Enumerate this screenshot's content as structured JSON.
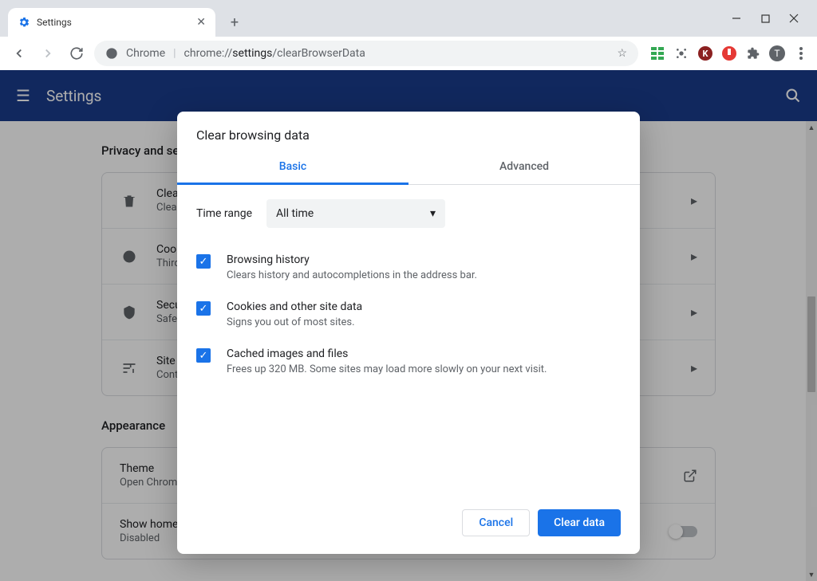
{
  "window": {
    "tab_title": "Settings"
  },
  "omnibox": {
    "prefix": "Chrome",
    "url_bold": "settings",
    "url_rest": "/clearBrowserData",
    "url_scheme": "chrome://"
  },
  "header": {
    "title": "Settings"
  },
  "sections": {
    "privacy": {
      "title": "Privacy and security",
      "rows": [
        {
          "title": "Clear browsing data",
          "sub": "Clear history, cookies, cache, and more"
        },
        {
          "title": "Cookies and other site data",
          "sub": "Third-party cookies are blocked in Incognito mode"
        },
        {
          "title": "Security",
          "sub": "Safe Browsing (protection from dangerous sites) and other security settings"
        },
        {
          "title": "Site Settings",
          "sub": "Controls what information sites can use and show"
        }
      ]
    },
    "appearance": {
      "title": "Appearance",
      "rows": [
        {
          "title": "Theme",
          "sub": "Open Chrome Web Store"
        },
        {
          "title": "Show home button",
          "sub": "Disabled"
        }
      ]
    }
  },
  "dialog": {
    "title": "Clear browsing data",
    "tabs": {
      "basic": "Basic",
      "advanced": "Advanced"
    },
    "time_range_label": "Time range",
    "time_range_value": "All time",
    "options": [
      {
        "title": "Browsing history",
        "sub": "Clears history and autocompletions in the address bar."
      },
      {
        "title": "Cookies and other site data",
        "sub": "Signs you out of most sites."
      },
      {
        "title": "Cached images and files",
        "sub": "Frees up 320 MB. Some sites may load more slowly on your next visit."
      }
    ],
    "cancel": "Cancel",
    "confirm": "Clear data"
  },
  "avatar_letter": "T"
}
